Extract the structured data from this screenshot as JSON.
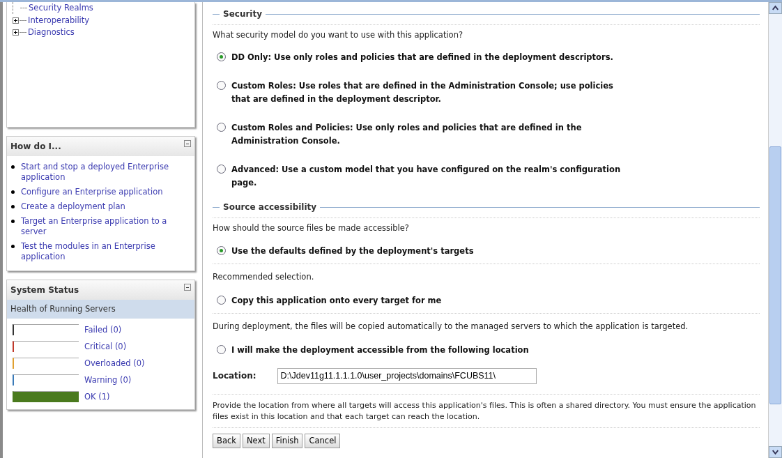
{
  "tree": [
    {
      "label": "Security Realms",
      "expandable": false
    },
    {
      "label": "Interoperability",
      "expandable": true
    },
    {
      "label": "Diagnostics",
      "expandable": true
    }
  ],
  "how_do_i": {
    "title": "How do I...",
    "links": [
      "Start and stop a deployed Enterprise application",
      "Configure an Enterprise application",
      "Create a deployment plan",
      "Target an Enterprise application to a server",
      "Test the modules in an Enterprise application"
    ]
  },
  "system_status": {
    "title": "System Status",
    "subtitle": "Health of Running Servers",
    "items": [
      {
        "label": "Failed (0)",
        "color": "#333333",
        "level": 0
      },
      {
        "label": "Critical (0)",
        "color": "#c0392b",
        "level": 0
      },
      {
        "label": "Overloaded (0)",
        "color": "#e0a030",
        "level": 0
      },
      {
        "label": "Warning (0)",
        "color": "#3a7ab8",
        "level": 0
      },
      {
        "label": "OK (1)",
        "color": "#4a7a1e",
        "level": 1
      }
    ]
  },
  "sections": [
    {
      "title": "Security",
      "question": "What security model do you want to use with this application?",
      "options": [
        {
          "label": "DD Only: Use only roles and policies that are defined in the deployment descriptors.",
          "selected": true
        },
        {
          "label": "Custom Roles: Use roles that are defined in the Administration Console; use policies that are defined in the deployment descriptor.",
          "selected": false
        },
        {
          "label": "Custom Roles and Policies: Use only roles and policies that are defined in the Administration Console.",
          "selected": false
        },
        {
          "label": "Advanced: Use a custom model that you have configured on the realm's configuration page.",
          "selected": false
        }
      ]
    },
    {
      "title": "Source accessibility",
      "question": "How should the source files be made accessible?",
      "options": [
        {
          "label": "Use the defaults defined by the deployment's targets",
          "selected": true,
          "note": "Recommended selection."
        },
        {
          "label": "Copy this application onto every target for me",
          "selected": false,
          "note": "During deployment, the files will be copied automatically to the managed servers to which the application is targeted."
        },
        {
          "label": "I will make the deployment accessible from the following location",
          "selected": false
        }
      ]
    }
  ],
  "location": {
    "label": "Location:",
    "value": "D:\\Jdev11g11.1.1.1.0\\user_projects\\domains\\FCUBS11\\",
    "help": "Provide the location from where all targets will access this application's files. This is often a shared directory. You must ensure the application files exist in this location and that each target can reach the location."
  },
  "buttons": [
    "Back",
    "Next",
    "Finish",
    "Cancel"
  ]
}
